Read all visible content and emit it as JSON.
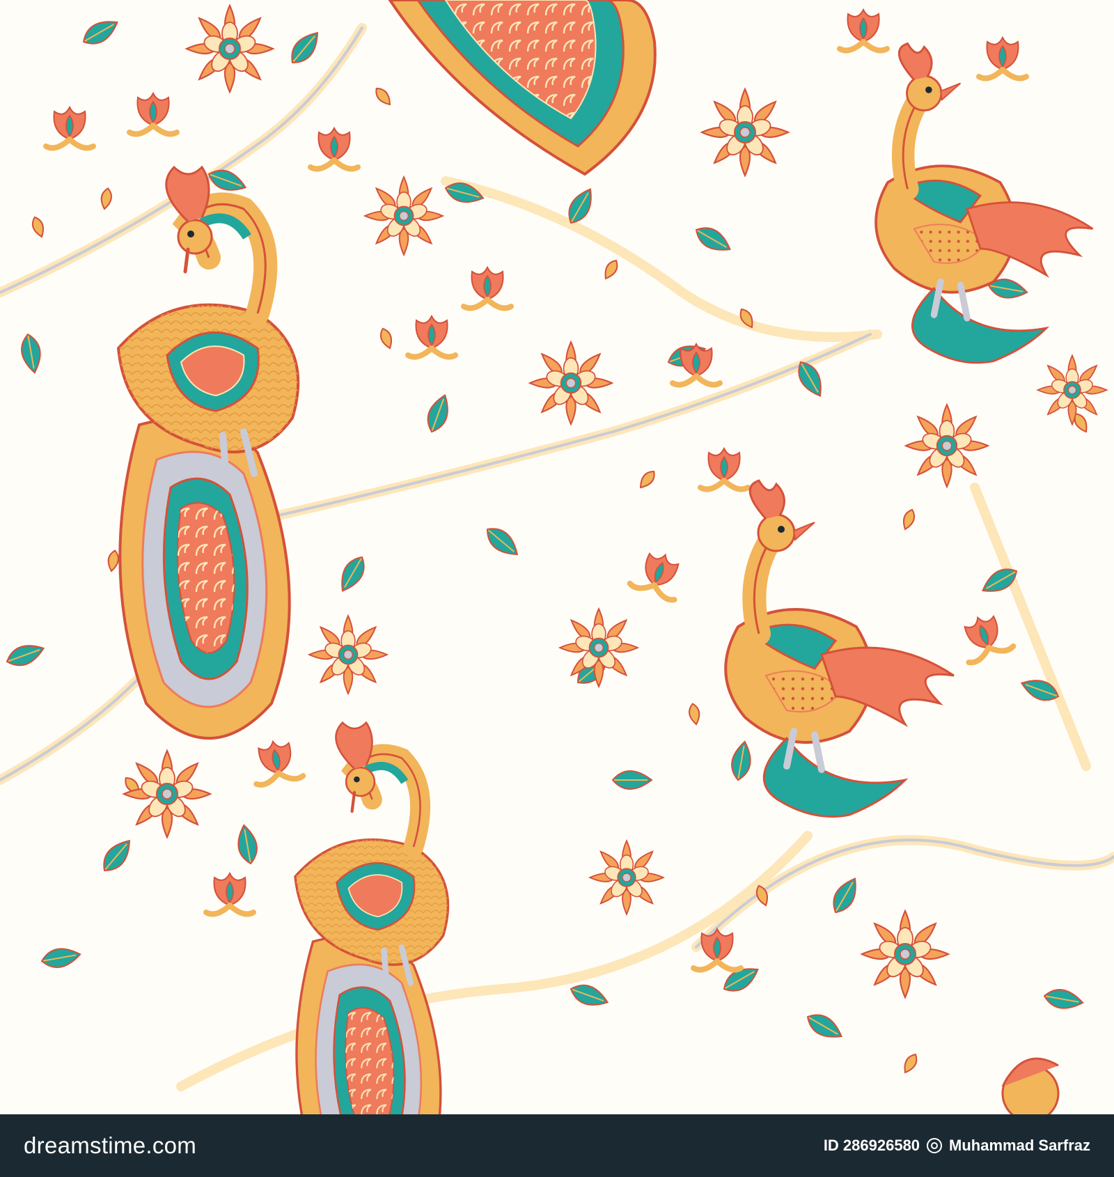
{
  "palette": {
    "teal": "#23a69c",
    "coral": "#ef7a5c",
    "ochre": "#f2b55a",
    "cream": "#fde6b8",
    "grey": "#c9cbd6",
    "red": "#d4513a",
    "background": "#fffdf8",
    "footer": "#1b2a32"
  },
  "footer": {
    "brand": "dreamstime.com",
    "id_label": "ID 286926580",
    "author": "Muhammad Sarfraz"
  }
}
